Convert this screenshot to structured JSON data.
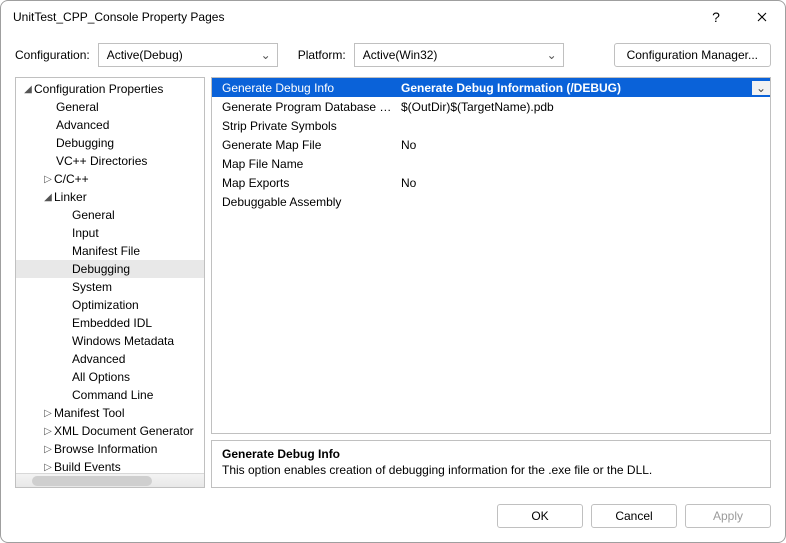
{
  "window": {
    "title": "UnitTest_CPP_Console Property Pages"
  },
  "toolbar": {
    "configLabel": "Configuration:",
    "configValue": "Active(Debug)",
    "platformLabel": "Platform:",
    "platformValue": "Active(Win32)",
    "managerLabel": "Configuration Manager..."
  },
  "tree": {
    "root": "Configuration Properties",
    "general": "General",
    "advanced": "Advanced",
    "debugging": "Debugging",
    "vcpp": "VC++ Directories",
    "ccpp": "C/C++",
    "linker": "Linker",
    "linker_general": "General",
    "linker_input": "Input",
    "linker_manifest": "Manifest File",
    "linker_debugging": "Debugging",
    "linker_system": "System",
    "linker_optimization": "Optimization",
    "linker_embedded": "Embedded IDL",
    "linker_winmd": "Windows Metadata",
    "linker_advanced": "Advanced",
    "linker_alloptions": "All Options",
    "linker_cmdline": "Command Line",
    "manifesttool": "Manifest Tool",
    "xmldoc": "XML Document Generator",
    "browseinfo": "Browse Information",
    "buildevents": "Build Events"
  },
  "grid": {
    "rows": [
      {
        "name": "Generate Debug Info",
        "value": "Generate Debug Information (/DEBUG)",
        "selected": true,
        "hasDropdown": true
      },
      {
        "name": "Generate Program Database File",
        "value": "$(OutDir)$(TargetName).pdb"
      },
      {
        "name": "Strip Private Symbols",
        "value": ""
      },
      {
        "name": "Generate Map File",
        "value": "No"
      },
      {
        "name": "Map File Name",
        "value": ""
      },
      {
        "name": "Map Exports",
        "value": "No"
      },
      {
        "name": "Debuggable Assembly",
        "value": ""
      }
    ]
  },
  "desc": {
    "title": "Generate Debug Info",
    "text": "This option enables creation of debugging information for the .exe file or the DLL."
  },
  "footer": {
    "ok": "OK",
    "cancel": "Cancel",
    "apply": "Apply"
  }
}
